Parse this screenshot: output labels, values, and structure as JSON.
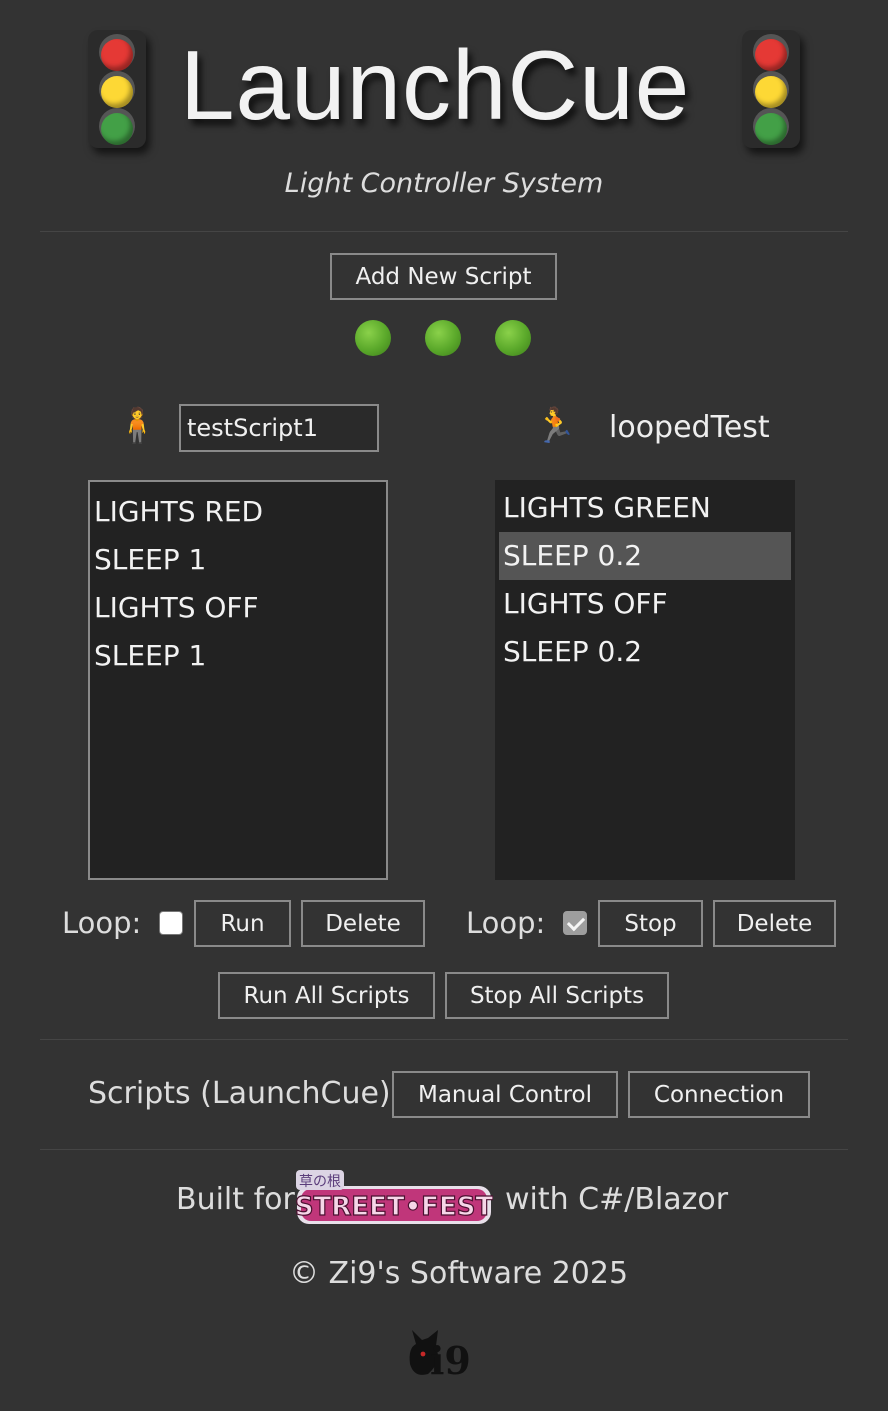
{
  "header": {
    "title": "LaunchCue",
    "subtitle": "Light Controller System",
    "traffic_light_icon": "traffic-light-icon"
  },
  "toolbar": {
    "add_script_label": "Add New Script",
    "status_dots": [
      "green",
      "green",
      "green"
    ]
  },
  "scripts": [
    {
      "icon": "person-standing-icon",
      "name": "testScript1",
      "editable_name": true,
      "commands": [
        "LIGHTS RED",
        "SLEEP 1",
        "LIGHTS OFF",
        "SLEEP 1"
      ],
      "selected_index": null,
      "loop_label": "Loop:",
      "loop": false,
      "run_label": "Run",
      "delete_label": "Delete"
    },
    {
      "icon": "person-running-icon",
      "name": "loopedTest",
      "editable_name": false,
      "commands": [
        "LIGHTS GREEN",
        "SLEEP 0.2",
        "LIGHTS OFF",
        "SLEEP 0.2"
      ],
      "selected_index": 1,
      "loop_label": "Loop:",
      "loop": true,
      "run_label": "Stop",
      "delete_label": "Delete"
    }
  ],
  "global_actions": {
    "run_all_label": "Run All Scripts",
    "stop_all_label": "Stop All Scripts"
  },
  "nav": {
    "current": "Scripts (LaunchCue)",
    "manual_label": "Manual Control",
    "connection_label": "Connection"
  },
  "footer": {
    "built_for": "Built for",
    "with_text": "with C#/Blazor",
    "logo_text": "STREET FEST",
    "logo_top_text": "草の根",
    "copyright": "© Zi9's Software 2025",
    "zi9_logo_text": "Zi9"
  },
  "colors": {
    "background": "#333333",
    "listbox": "#222222",
    "status_green": "#5aa82a",
    "lamp_red": "#e53935",
    "lamp_yellow": "#fdd835",
    "lamp_green": "#43a047"
  }
}
